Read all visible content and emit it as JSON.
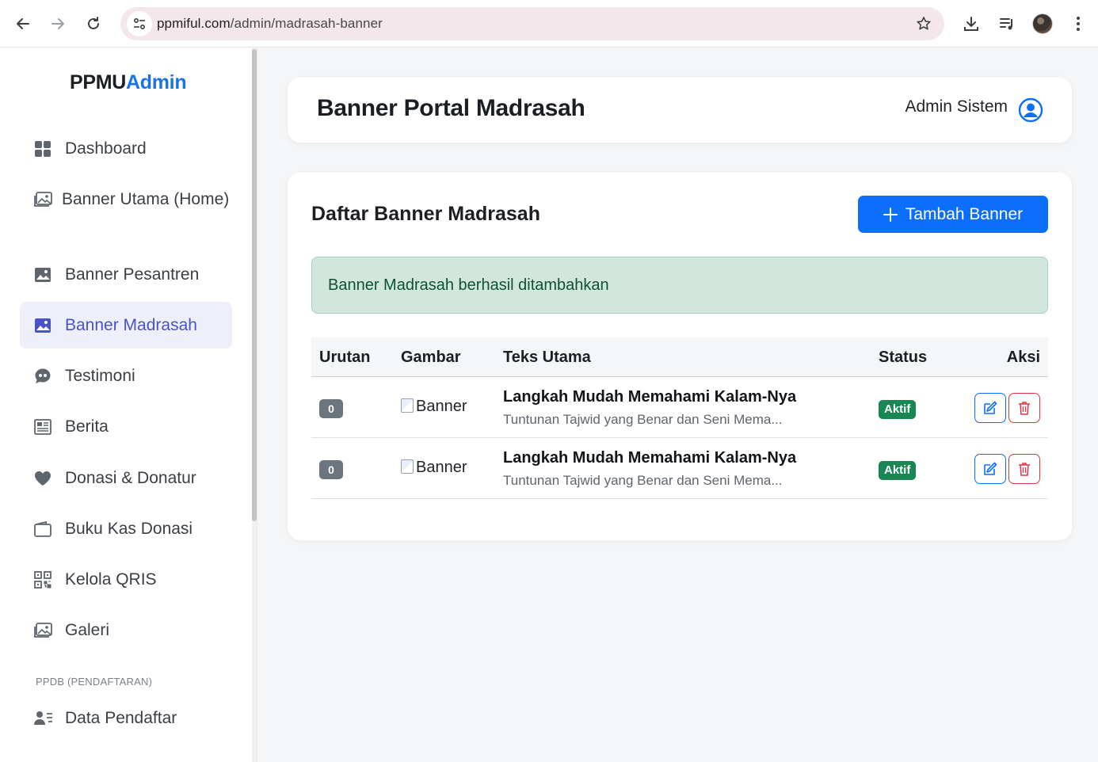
{
  "browser": {
    "url_host": "ppmiful.com",
    "url_path": "/admin/madrasah-banner"
  },
  "sidebar": {
    "brand_main": "PPMU",
    "brand_accent": "Admin",
    "items": [
      {
        "label": "Dashboard",
        "icon": "grid-icon"
      },
      {
        "label": "Banner Utama (Home)",
        "icon": "images-icon"
      },
      {
        "label": "Banner Pesantren",
        "icon": "image-icon"
      },
      {
        "label": "Banner Madrasah",
        "icon": "image-icon",
        "active": true
      },
      {
        "label": "Testimoni",
        "icon": "chat-quote-icon"
      },
      {
        "label": "Berita",
        "icon": "newspaper-icon"
      },
      {
        "label": "Donasi & Donatur",
        "icon": "heart-icon"
      },
      {
        "label": "Buku Kas Donasi",
        "icon": "wallet-icon"
      },
      {
        "label": "Kelola QRIS",
        "icon": "qr-code-icon"
      },
      {
        "label": "Galeri",
        "icon": "images-icon"
      }
    ],
    "section_ppdb": "PPDB (PENDAFTARAN)",
    "ppdb_items": [
      {
        "label": "Data Pendaftar",
        "icon": "person-lines-icon"
      }
    ]
  },
  "header": {
    "title": "Banner Portal Madrasah",
    "user_name": "Admin Sistem"
  },
  "content": {
    "section_title": "Daftar Banner Madrasah",
    "add_button": "Tambah Banner",
    "alert": "Banner Madrasah berhasil ditambahkan",
    "columns": [
      "Urutan",
      "Gambar",
      "Teks Utama",
      "Status",
      "Aksi"
    ],
    "rows": [
      {
        "order": "0",
        "image_alt": "Banner",
        "title": "Langkah Mudah Memahami Kalam-Nya",
        "subtitle": "Tuntunan Tajwid yang Benar dan Seni Mema...",
        "status": "Aktif"
      },
      {
        "order": "0",
        "image_alt": "Banner",
        "title": "Langkah Mudah Memahami Kalam-Nya",
        "subtitle": "Tuntunan Tajwid yang Benar dan Seni Mema...",
        "status": "Aktif"
      }
    ]
  },
  "colors": {
    "primary": "#0d6efd",
    "success": "#198754",
    "danger": "#dc3545",
    "active_nav": "#4a52c9",
    "alert_bg": "#d1e7dd"
  }
}
